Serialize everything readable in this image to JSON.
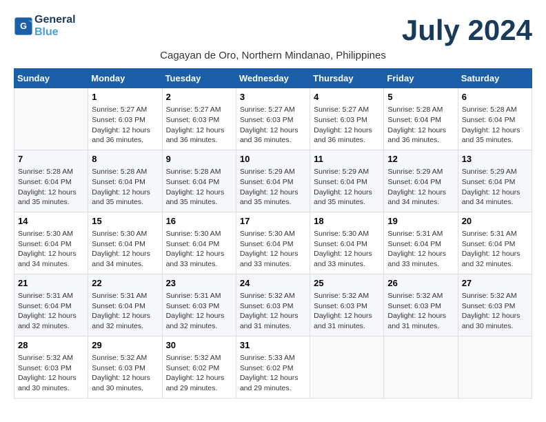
{
  "logo": {
    "line1": "General",
    "line2": "Blue"
  },
  "title": "July 2024",
  "subtitle": "Cagayan de Oro, Northern Mindanao, Philippines",
  "days_of_week": [
    "Sunday",
    "Monday",
    "Tuesday",
    "Wednesday",
    "Thursday",
    "Friday",
    "Saturday"
  ],
  "weeks": [
    [
      {
        "day": "",
        "info": ""
      },
      {
        "day": "1",
        "info": "Sunrise: 5:27 AM\nSunset: 6:03 PM\nDaylight: 12 hours\nand 36 minutes."
      },
      {
        "day": "2",
        "info": "Sunrise: 5:27 AM\nSunset: 6:03 PM\nDaylight: 12 hours\nand 36 minutes."
      },
      {
        "day": "3",
        "info": "Sunrise: 5:27 AM\nSunset: 6:03 PM\nDaylight: 12 hours\nand 36 minutes."
      },
      {
        "day": "4",
        "info": "Sunrise: 5:27 AM\nSunset: 6:03 PM\nDaylight: 12 hours\nand 36 minutes."
      },
      {
        "day": "5",
        "info": "Sunrise: 5:28 AM\nSunset: 6:04 PM\nDaylight: 12 hours\nand 36 minutes."
      },
      {
        "day": "6",
        "info": "Sunrise: 5:28 AM\nSunset: 6:04 PM\nDaylight: 12 hours\nand 35 minutes."
      }
    ],
    [
      {
        "day": "7",
        "info": "Sunrise: 5:28 AM\nSunset: 6:04 PM\nDaylight: 12 hours\nand 35 minutes."
      },
      {
        "day": "8",
        "info": "Sunrise: 5:28 AM\nSunset: 6:04 PM\nDaylight: 12 hours\nand 35 minutes."
      },
      {
        "day": "9",
        "info": "Sunrise: 5:28 AM\nSunset: 6:04 PM\nDaylight: 12 hours\nand 35 minutes."
      },
      {
        "day": "10",
        "info": "Sunrise: 5:29 AM\nSunset: 6:04 PM\nDaylight: 12 hours\nand 35 minutes."
      },
      {
        "day": "11",
        "info": "Sunrise: 5:29 AM\nSunset: 6:04 PM\nDaylight: 12 hours\nand 35 minutes."
      },
      {
        "day": "12",
        "info": "Sunrise: 5:29 AM\nSunset: 6:04 PM\nDaylight: 12 hours\nand 34 minutes."
      },
      {
        "day": "13",
        "info": "Sunrise: 5:29 AM\nSunset: 6:04 PM\nDaylight: 12 hours\nand 34 minutes."
      }
    ],
    [
      {
        "day": "14",
        "info": "Sunrise: 5:30 AM\nSunset: 6:04 PM\nDaylight: 12 hours\nand 34 minutes."
      },
      {
        "day": "15",
        "info": "Sunrise: 5:30 AM\nSunset: 6:04 PM\nDaylight: 12 hours\nand 34 minutes."
      },
      {
        "day": "16",
        "info": "Sunrise: 5:30 AM\nSunset: 6:04 PM\nDaylight: 12 hours\nand 33 minutes."
      },
      {
        "day": "17",
        "info": "Sunrise: 5:30 AM\nSunset: 6:04 PM\nDaylight: 12 hours\nand 33 minutes."
      },
      {
        "day": "18",
        "info": "Sunrise: 5:30 AM\nSunset: 6:04 PM\nDaylight: 12 hours\nand 33 minutes."
      },
      {
        "day": "19",
        "info": "Sunrise: 5:31 AM\nSunset: 6:04 PM\nDaylight: 12 hours\nand 33 minutes."
      },
      {
        "day": "20",
        "info": "Sunrise: 5:31 AM\nSunset: 6:04 PM\nDaylight: 12 hours\nand 32 minutes."
      }
    ],
    [
      {
        "day": "21",
        "info": "Sunrise: 5:31 AM\nSunset: 6:04 PM\nDaylight: 12 hours\nand 32 minutes."
      },
      {
        "day": "22",
        "info": "Sunrise: 5:31 AM\nSunset: 6:04 PM\nDaylight: 12 hours\nand 32 minutes."
      },
      {
        "day": "23",
        "info": "Sunrise: 5:31 AM\nSunset: 6:03 PM\nDaylight: 12 hours\nand 32 minutes."
      },
      {
        "day": "24",
        "info": "Sunrise: 5:32 AM\nSunset: 6:03 PM\nDaylight: 12 hours\nand 31 minutes."
      },
      {
        "day": "25",
        "info": "Sunrise: 5:32 AM\nSunset: 6:03 PM\nDaylight: 12 hours\nand 31 minutes."
      },
      {
        "day": "26",
        "info": "Sunrise: 5:32 AM\nSunset: 6:03 PM\nDaylight: 12 hours\nand 31 minutes."
      },
      {
        "day": "27",
        "info": "Sunrise: 5:32 AM\nSunset: 6:03 PM\nDaylight: 12 hours\nand 30 minutes."
      }
    ],
    [
      {
        "day": "28",
        "info": "Sunrise: 5:32 AM\nSunset: 6:03 PM\nDaylight: 12 hours\nand 30 minutes."
      },
      {
        "day": "29",
        "info": "Sunrise: 5:32 AM\nSunset: 6:03 PM\nDaylight: 12 hours\nand 30 minutes."
      },
      {
        "day": "30",
        "info": "Sunrise: 5:32 AM\nSunset: 6:02 PM\nDaylight: 12 hours\nand 29 minutes."
      },
      {
        "day": "31",
        "info": "Sunrise: 5:33 AM\nSunset: 6:02 PM\nDaylight: 12 hours\nand 29 minutes."
      },
      {
        "day": "",
        "info": ""
      },
      {
        "day": "",
        "info": ""
      },
      {
        "day": "",
        "info": ""
      }
    ]
  ]
}
